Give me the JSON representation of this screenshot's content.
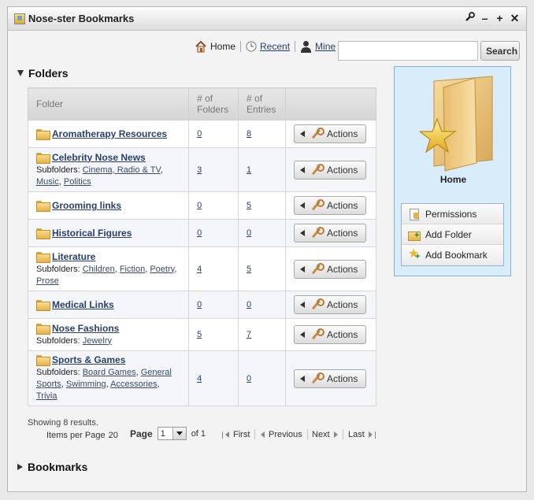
{
  "window": {
    "title": "Nose-ster Bookmarks"
  },
  "nav": {
    "home": "Home",
    "recent": "Recent",
    "mine": "Mine"
  },
  "search": {
    "placeholder": "",
    "button": "Search"
  },
  "sections": {
    "folders": "Folders",
    "bookmarks": "Bookmarks"
  },
  "table": {
    "headers": {
      "folder": "Folder",
      "folders_count": "# of Folders",
      "entries_count": "# of Entries"
    },
    "subfolders_label": "Subfolders",
    "actions_label": "Actions",
    "rows": [
      {
        "name": "Aromatherapy Resources",
        "folders": "0",
        "entries": "8",
        "subfolders": []
      },
      {
        "name": "Celebrity Nose News",
        "folders": "3",
        "entries": "1",
        "subfolders": [
          "Cinema, Radio & TV",
          "Music",
          "Politics"
        ]
      },
      {
        "name": "Grooming links",
        "folders": "0",
        "entries": "5",
        "subfolders": []
      },
      {
        "name": "Historical Figures",
        "folders": "0",
        "entries": "0",
        "subfolders": []
      },
      {
        "name": "Literature",
        "folders": "4",
        "entries": "5",
        "subfolders": [
          "Children",
          "Fiction",
          "Poetry",
          "Prose"
        ]
      },
      {
        "name": "Medical Links",
        "folders": "0",
        "entries": "0",
        "subfolders": []
      },
      {
        "name": "Nose Fashions",
        "folders": "5",
        "entries": "7",
        "subfolders": [
          "Jewelry"
        ]
      },
      {
        "name": "Sports & Games",
        "folders": "4",
        "entries": "0",
        "subfolders": [
          "Board Games",
          "General Sports",
          "Swimming",
          "Accessories",
          "Trivia"
        ]
      }
    ]
  },
  "pagination": {
    "showing": "Showing 8 results.",
    "items_per_page_label": "Items per Page",
    "items_per_page": "20",
    "page_label": "Page",
    "page_value": "1",
    "of_label": "of 1",
    "first": "First",
    "previous": "Previous",
    "next": "Next",
    "last": "Last"
  },
  "panel": {
    "title": "Home",
    "menu": [
      "Permissions",
      "Add Folder",
      "Add Bookmark"
    ]
  }
}
